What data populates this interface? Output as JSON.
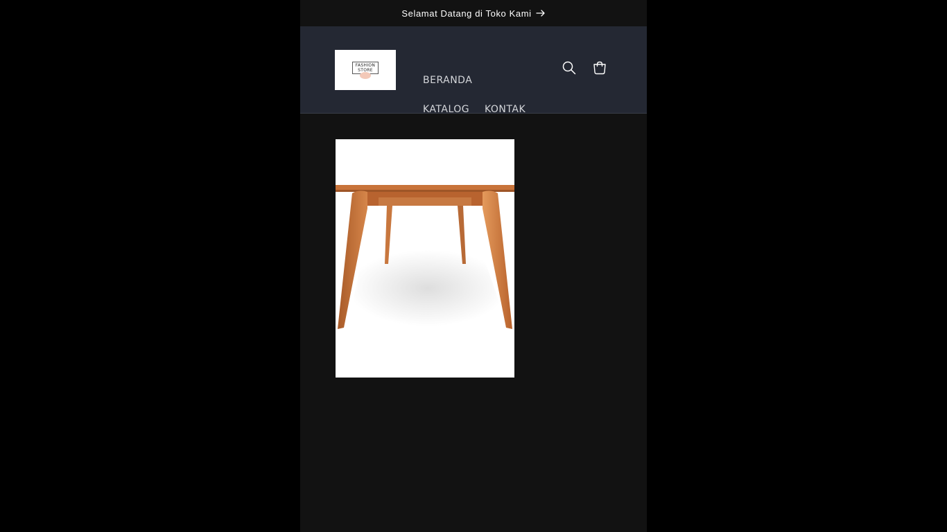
{
  "announcement": {
    "text": "Selamat Datang di Toko Kami",
    "icon": "arrow-right-icon"
  },
  "header": {
    "logo": {
      "line1": "FASHION",
      "line2": "STORE"
    },
    "nav": [
      {
        "label": "BERANDA"
      },
      {
        "label": "KATALOG"
      },
      {
        "label": "KONTAK"
      }
    ],
    "icons": {
      "search": "search-icon",
      "cart": "cart-icon"
    }
  },
  "colors": {
    "page_bg": "#121212",
    "header_bg": "#242833",
    "outer_bg": "#000000",
    "wood": "#c8733a"
  }
}
